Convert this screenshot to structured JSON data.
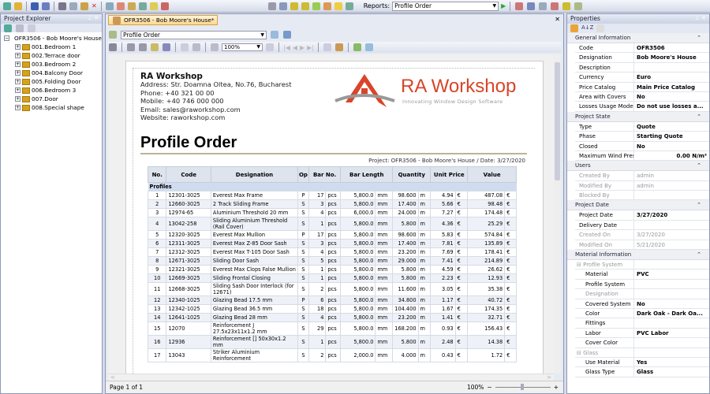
{
  "toolbar": {
    "reports_label": "Reports:",
    "reports_value": "Profile Order"
  },
  "explorer": {
    "title": "Project Explorer",
    "root": "OFR3506 - Bob Moore's House",
    "items": [
      "001.Bedroom 1",
      "002.Terrace door",
      "003.Bedroom 2",
      "004.Balcony Door",
      "005.Folding Door",
      "006.Bedroom 3",
      "007.Door",
      "008.Special shape"
    ]
  },
  "doc": {
    "tab": "OFR3506 - Bob Moore's House*",
    "report_select": "Profile Order",
    "zoom": "100%",
    "status_page": "Page 1 of 1",
    "status_zoom": "100%"
  },
  "report": {
    "company": "RA Workshop",
    "address": "Address: Str. Doamna Oltea, No.76, Bucharest",
    "phone": "Phone: +40 321 00 00",
    "mobile": "Mobile: +40 746 000 000",
    "email": "Email: sales@raworkshop.com",
    "website": "Website: raworkshop.com",
    "logo_name": "RA Workshop",
    "logo_tagline": "Innovating Window Design Software",
    "title": "Profile Order",
    "project_line": "Project: OFR3506 - Bob Moore's House / Date: 3/27/2020",
    "columns": [
      "No.",
      "Code",
      "Designation",
      "Op",
      "Bar No.",
      "Bar Length",
      "Quantity",
      "Unit Price",
      "Value"
    ],
    "group": "Profiles",
    "rows": [
      [
        "1",
        "12301-3025",
        "Everest Max Frame",
        "P",
        "17",
        "pcs",
        "5,800.0",
        "mm",
        "98.600",
        "m",
        "4.94",
        "€",
        "487.08",
        "€"
      ],
      [
        "2",
        "12660-3025",
        "2 Track Sliding Frame",
        "S",
        "3",
        "pcs",
        "5,800.0",
        "mm",
        "17.400",
        "m",
        "5.66",
        "€",
        "98.48",
        "€"
      ],
      [
        "3",
        "12974-65",
        "Aluminium Threshold 20 mm",
        "S",
        "4",
        "pcs",
        "6,000.0",
        "mm",
        "24.000",
        "m",
        "7.27",
        "€",
        "174.48",
        "€"
      ],
      [
        "4",
        "13042-258",
        "Sliding Aluminium Threshold (Rail Cover)",
        "S",
        "1",
        "pcs",
        "5,800.0",
        "mm",
        "5.800",
        "m",
        "4.36",
        "€",
        "25.29",
        "€"
      ],
      [
        "5",
        "12320-3025",
        "Everest Max Mullion",
        "P",
        "17",
        "pcs",
        "5,800.0",
        "mm",
        "98.600",
        "m",
        "5.83",
        "€",
        "574.84",
        "€"
      ],
      [
        "6",
        "12311-3025",
        "Everest Max Z-85 Door Sash",
        "S",
        "3",
        "pcs",
        "5,800.0",
        "mm",
        "17.400",
        "m",
        "7.81",
        "€",
        "135.89",
        "€"
      ],
      [
        "7",
        "12312-3025",
        "Everest Max T-105 Door Sash",
        "S",
        "4",
        "pcs",
        "5,800.0",
        "mm",
        "23.200",
        "m",
        "7.69",
        "€",
        "178.41",
        "€"
      ],
      [
        "8",
        "12671-3025",
        "Sliding Door Sash",
        "S",
        "5",
        "pcs",
        "5,800.0",
        "mm",
        "29.000",
        "m",
        "7.41",
        "€",
        "214.89",
        "€"
      ],
      [
        "9",
        "12321-3025",
        "Everest Max Clops False Mullion",
        "S",
        "1",
        "pcs",
        "5,800.0",
        "mm",
        "5.800",
        "m",
        "4.59",
        "€",
        "26.62",
        "€"
      ],
      [
        "10",
        "12669-3025",
        "Sliding Frontal Closing",
        "S",
        "1",
        "pcs",
        "5,800.0",
        "mm",
        "5.800",
        "m",
        "2.23",
        "€",
        "12.93",
        "€"
      ],
      [
        "11",
        "12668-3025",
        "Sliding Sash Door Interlock (for 12671)",
        "S",
        "2",
        "pcs",
        "5,800.0",
        "mm",
        "11.600",
        "m",
        "3.05",
        "€",
        "35.38",
        "€"
      ],
      [
        "12",
        "12340-1025",
        "Glazing Bead 17.5 mm",
        "P",
        "6",
        "pcs",
        "5,800.0",
        "mm",
        "34.800",
        "m",
        "1.17",
        "€",
        "40.72",
        "€"
      ],
      [
        "13",
        "12342-1025",
        "Glazing Bead 36.5 mm",
        "S",
        "18",
        "pcs",
        "5,800.0",
        "mm",
        "104.400",
        "m",
        "1.67",
        "€",
        "174.35",
        "€"
      ],
      [
        "14",
        "12641-1025",
        "Glazing Bead 28 mm",
        "S",
        "4",
        "pcs",
        "5,800.0",
        "mm",
        "23.200",
        "m",
        "1.41",
        "€",
        "32.71",
        "€"
      ],
      [
        "15",
        "12070",
        "Reinforcement J 27.5x23x11x1.2 mm",
        "S",
        "29",
        "pcs",
        "5,800.0",
        "mm",
        "168.200",
        "m",
        "0.93",
        "€",
        "156.43",
        "€"
      ],
      [
        "16",
        "12936",
        "Reinforcement [] 50x30x1.2 mm",
        "S",
        "1",
        "pcs",
        "5,800.0",
        "mm",
        "5.800",
        "m",
        "2.48",
        "€",
        "14.38",
        "€"
      ],
      [
        "17",
        "13043",
        "Striker Aluminium Reinforcement",
        "S",
        "2",
        "pcs",
        "2,000.0",
        "mm",
        "4.000",
        "m",
        "0.43",
        "€",
        "1.72",
        "€"
      ]
    ]
  },
  "properties": {
    "title": "Properties",
    "sections": [
      {
        "name": "General Information",
        "rows": [
          [
            "Code",
            "OFR3506"
          ],
          [
            "Designation",
            "Bob Moore's House"
          ],
          [
            "Description",
            ""
          ],
          [
            "Currency",
            "Euro"
          ],
          [
            "Price Catalog",
            "Main Price Catalog"
          ],
          [
            "Area with Covers",
            "No"
          ],
          [
            "Losses Usage Mode",
            "Do not use losses a..."
          ]
        ]
      },
      {
        "name": "Project State",
        "rows": [
          [
            "Type",
            "Quote"
          ],
          [
            "Phase",
            "Starting Quote"
          ],
          [
            "Closed",
            "No"
          ],
          [
            "Maximum Wind Press",
            "0.00 N/m²"
          ]
        ]
      },
      {
        "name": "Users",
        "rows": [
          [
            "Created By",
            "admin",
            "dis"
          ],
          [
            "Modified By",
            "admin",
            "dis"
          ],
          [
            "Blocked By",
            "",
            "dis"
          ]
        ]
      },
      {
        "name": "Project Date",
        "rows": [
          [
            "Project Date",
            "3/27/2020"
          ],
          [
            "Delivery Date",
            ""
          ],
          [
            "Created On",
            "3/27/2020",
            "dis"
          ],
          [
            "Modified On",
            "5/21/2020",
            "dis"
          ]
        ]
      },
      {
        "name": "Material Information",
        "rows": [
          [
            "⊟ Profile System",
            "",
            "grp2"
          ],
          [
            "Material",
            "PVC",
            "sub"
          ],
          [
            "Profile System",
            "",
            "sub"
          ],
          [
            "Designation",
            "",
            "sub dis"
          ],
          [
            "Covered System",
            "No",
            "sub"
          ],
          [
            "Color",
            "Dark Oak - Dark Oa...",
            "sub"
          ],
          [
            "Fittings",
            "",
            "sub"
          ],
          [
            "Labor",
            "PVC Labor",
            "sub"
          ],
          [
            "Cover Color",
            "",
            "sub"
          ],
          [
            "⊟ Glass",
            "",
            "grp2"
          ],
          [
            "Use Material",
            "Yes",
            "sub"
          ],
          [
            "Glass Type",
            "Glass",
            "sub"
          ]
        ]
      }
    ]
  },
  "colors": {
    "accent": "#d8452a",
    "header": "#dde4ee",
    "group": "#cfdcf0"
  }
}
